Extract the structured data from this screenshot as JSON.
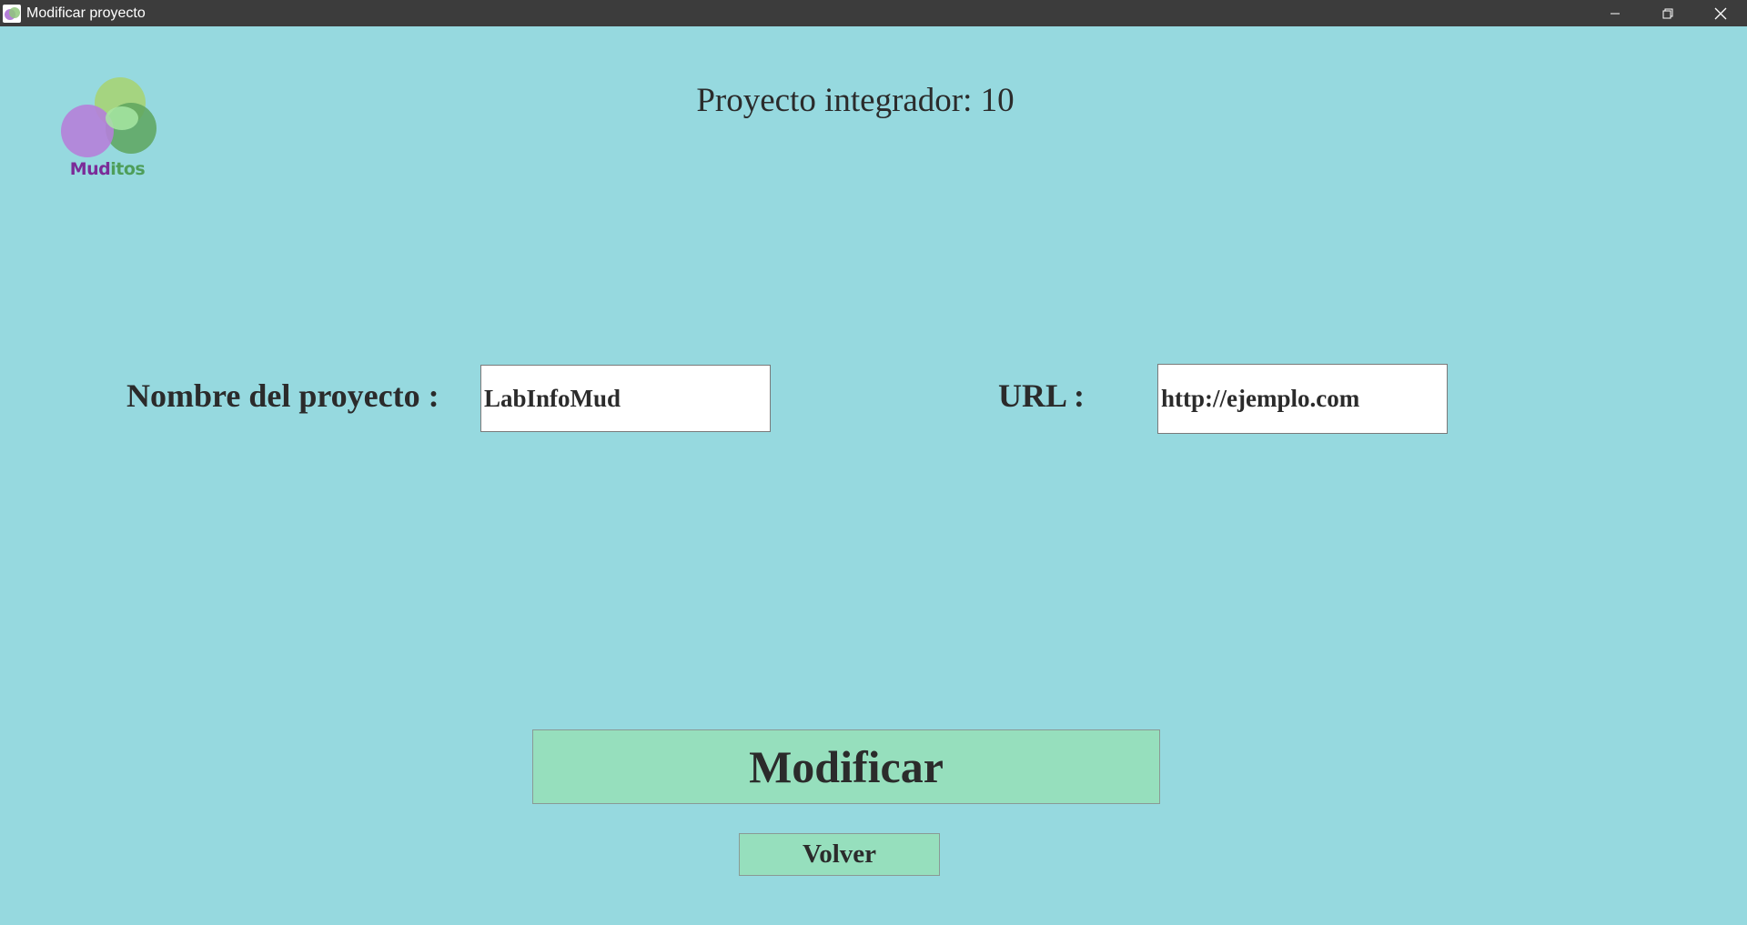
{
  "window": {
    "title": "Modificar proyecto",
    "controls": {
      "minimize_icon": "minimize-icon",
      "maximize_icon": "restore-icon",
      "close_icon": "close-icon"
    }
  },
  "logo": {
    "text_part1": "Mud",
    "text_part2": "itos",
    "colors": {
      "purple": "#b57fd9",
      "green_light": "#a5d47a",
      "green_dark": "#5ea55e",
      "text_purple": "#7b2c98",
      "text_green": "#4e9e5a"
    }
  },
  "header": {
    "title": "Proyecto integrador: 10"
  },
  "form": {
    "name_label": "Nombre del proyecto :",
    "name_value": "LabInfoMud",
    "url_label": "URL :",
    "url_value": "http://ejemplo.com"
  },
  "actions": {
    "modify_label": "Modificar",
    "back_label": "Volver"
  },
  "colors": {
    "background": "#96d9df",
    "button": "#96dfbd",
    "titlebar": "#3c3c3c"
  }
}
